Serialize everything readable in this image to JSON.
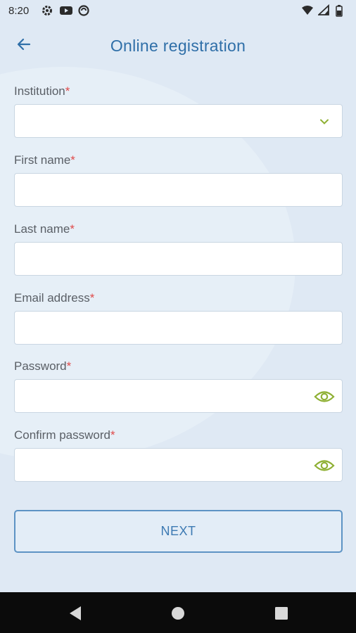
{
  "status_bar": {
    "time": "8:20",
    "icons_left": [
      "gear-icon",
      "youtube-icon",
      "sync-icon"
    ],
    "icons_right": [
      "wifi-icon",
      "signal-icon",
      "battery-icon"
    ]
  },
  "app_bar": {
    "title": "Online registration",
    "back_icon": "arrow-left-icon"
  },
  "form": {
    "required_mark": "*",
    "fields": [
      {
        "label": "Institution",
        "value": "",
        "icon": "chevron-down-icon"
      },
      {
        "label": "First name",
        "value": ""
      },
      {
        "label": "Last name",
        "value": ""
      },
      {
        "label": "Email address",
        "value": ""
      },
      {
        "label": "Password",
        "value": "",
        "icon": "eye-icon"
      },
      {
        "label": "Confirm password",
        "value": "",
        "icon": "eye-icon"
      }
    ]
  },
  "next_button": {
    "label": "NEXT"
  },
  "colors": {
    "accent": "#2f6fa8",
    "icon_green": "#8fb034",
    "required": "#e04a4a",
    "background": "#dfe9f4"
  },
  "nav_bar": {
    "buttons": [
      "back-triangle-icon",
      "home-circle-icon",
      "recents-square-icon"
    ]
  }
}
